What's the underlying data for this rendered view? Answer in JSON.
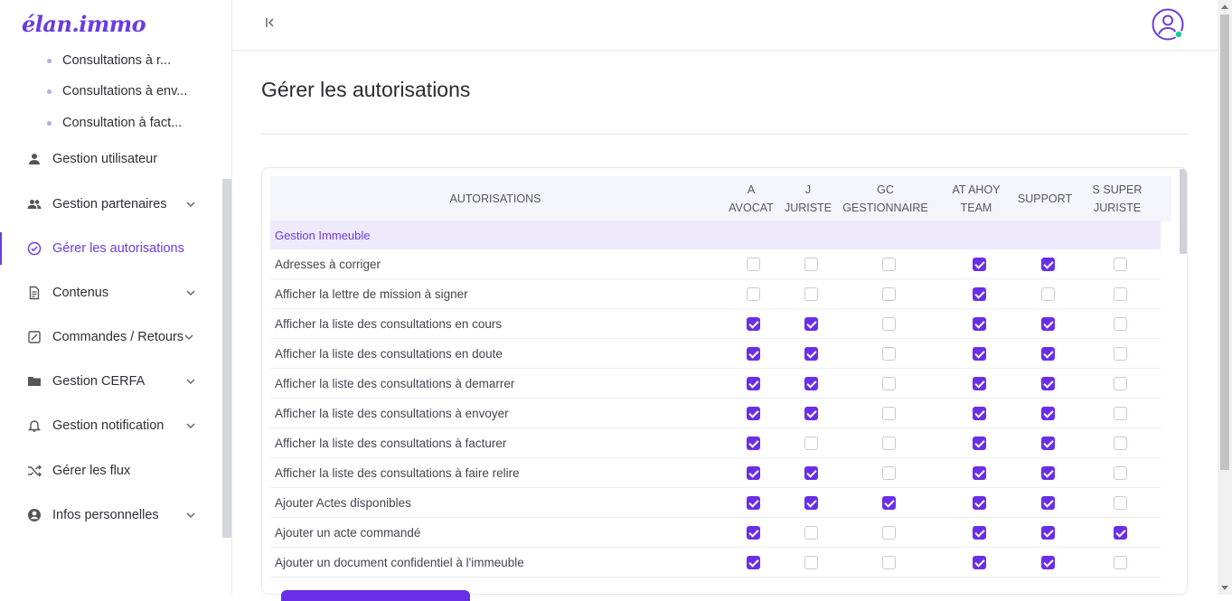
{
  "app": {
    "logo": "élan.immo"
  },
  "sidebar": {
    "sub_items": [
      "Consultations à r...",
      "Consultations à env...",
      "Consultation à fact..."
    ],
    "items": [
      {
        "label": "Gestion utilisateur",
        "icon": "user-icon",
        "has_chevron": false
      },
      {
        "label": "Gestion partenaires",
        "icon": "users-icon",
        "has_chevron": true
      },
      {
        "label": "Gérer les autorisations",
        "icon": "check-circle-icon",
        "has_chevron": false,
        "active": true
      },
      {
        "label": "Contenus",
        "icon": "document-icon",
        "has_chevron": true
      },
      {
        "label": "Commandes / Retours",
        "icon": "edit-box-icon",
        "has_chevron": true
      },
      {
        "label": "Gestion CERFA",
        "icon": "folder-icon",
        "has_chevron": true
      },
      {
        "label": "Gestion notification",
        "icon": "bell-icon",
        "has_chevron": true
      },
      {
        "label": "Gérer les flux",
        "icon": "shuffle-icon",
        "has_chevron": false
      },
      {
        "label": "Infos personnelles",
        "icon": "account-circle-icon",
        "has_chevron": true
      }
    ]
  },
  "header": {
    "collapse_icon": "collapse-left-icon",
    "avatar_icon": "user-avatar-icon",
    "status_color": "#1ec99a"
  },
  "page": {
    "title": "Gérer les autorisations"
  },
  "table": {
    "columns": [
      {
        "line1": "AUTORISATIONS",
        "line2": ""
      },
      {
        "line1": "A",
        "line2": "AVOCAT"
      },
      {
        "line1": "J",
        "line2": "JURISTE"
      },
      {
        "line1": "GC",
        "line2": "GESTIONNAIRE"
      },
      {
        "line1": "AT AHOY",
        "line2": "TEAM"
      },
      {
        "line1": "SUPPORT",
        "line2": ""
      },
      {
        "line1": "S SUPER",
        "line2": "JURISTE"
      }
    ],
    "section": "Gestion Immeuble",
    "rows": [
      {
        "label": "Adresses à corriger",
        "checks": [
          false,
          false,
          false,
          true,
          true,
          false
        ]
      },
      {
        "label": "Afficher la lettre de mission à signer",
        "checks": [
          false,
          false,
          false,
          true,
          false,
          false
        ]
      },
      {
        "label": "Afficher la liste des consultations en cours",
        "checks": [
          true,
          true,
          false,
          true,
          true,
          false
        ]
      },
      {
        "label": "Afficher la liste des consultations en doute",
        "checks": [
          true,
          true,
          false,
          true,
          true,
          false
        ]
      },
      {
        "label": "Afficher la liste des consultations à demarrer",
        "checks": [
          true,
          true,
          false,
          true,
          true,
          false
        ]
      },
      {
        "label": "Afficher la liste des consultations à envoyer",
        "checks": [
          true,
          true,
          false,
          true,
          true,
          false
        ]
      },
      {
        "label": "Afficher la liste des consultations à facturer",
        "checks": [
          true,
          false,
          false,
          true,
          true,
          false
        ]
      },
      {
        "label": "Afficher la liste des consultations à faire relire",
        "checks": [
          true,
          true,
          false,
          true,
          true,
          false
        ]
      },
      {
        "label": "Ajouter Actes disponibles",
        "checks": [
          true,
          true,
          true,
          true,
          true,
          false
        ]
      },
      {
        "label": "Ajouter un acte commandé",
        "checks": [
          true,
          false,
          false,
          true,
          true,
          true
        ]
      },
      {
        "label": "Ajouter un document confidentiel à l'immeuble",
        "checks": [
          true,
          false,
          false,
          true,
          true,
          false
        ]
      }
    ]
  },
  "colors": {
    "accent": "#6a2ee8",
    "section_bg": "#efe9fc"
  }
}
